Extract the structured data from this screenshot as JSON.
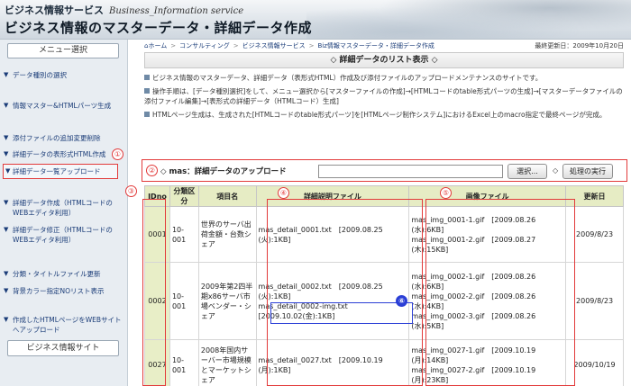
{
  "header": {
    "service_jp": "ビジネス情報サービス",
    "service_en": "Business_Information service",
    "title": "ビジネス情報のマスターデータ・詳細データ作成"
  },
  "sidebar": {
    "menu_title": "メニュー選択",
    "items": [
      {
        "label": "データ種別の選択"
      },
      {
        "label": "情報マスター&HTMLパーツ生成"
      },
      {
        "label": "添付ファイルの追加変更削除"
      },
      {
        "label": "詳細データの表形式HTML作成"
      },
      {
        "label": "詳細データ一覧アップロード"
      },
      {
        "label": "詳細データ作成（HTMLコードのWEBエディタ利用）"
      },
      {
        "label": "詳細データ修正（HTMLコードのWEBエディタ利用）"
      },
      {
        "label": "分類・タイトルファイル更新"
      },
      {
        "label": "背景カラー指定NOリスト表示"
      },
      {
        "label": "作成したHTMLページをWEBサイトへアップロード"
      }
    ],
    "bottom_button": "ビジネス情報サイト"
  },
  "breadcrumb": {
    "home": "ホーム",
    "items": [
      "コンサルティング",
      "ビジネス情報サービス",
      "Biz情報マスターデータ・詳細データ作成"
    ],
    "updated": "最終更新日：2009年10月20日"
  },
  "section": {
    "title": "◇ 詳細データのリスト表示 ◇",
    "descriptions": [
      "ビジネス情報のマスターデータ、詳細データ（表形式HTML）作成及び添付ファイルのアップロードメンテナンスのサイトです。",
      "操作手順は、[データ種別選択]をして、メニュー選択から[マスターファイルの作成]→[HTMLコードのtable形式パーツの生成]→[マスターデータファイルの添付ファイル編集]→[表形式の詳細データ（HTMLコード）生成]",
      "HTMLページ生成は、生成された[HTMLコードのtable形式パーツ]を[HTMLページ制作システム]におけるExcel上のmacro指定で最終ページが完成。"
    ]
  },
  "upload": {
    "label": "◇ mas：詳細データのアップロード",
    "input_value": "",
    "select_button": "選択...",
    "run_label": "◇",
    "run_button": "処理の実行"
  },
  "table": {
    "headers": [
      "IDno",
      "分類区分",
      "項目名",
      "詳細説明ファイル",
      "画像ファイル",
      "更新日"
    ],
    "rows": [
      {
        "id": "0001",
        "cls": "10-001",
        "name": "世界のサーバ出荷金額・台数シェア",
        "files": [
          "mas_detail_0001.txt　[2009.08.25",
          "(火):1KB]"
        ],
        "images": [
          "mas_img_0001-1.gif　[2009.08.26",
          "(水):6KB]",
          "mas_img_0001-2.gif　[2009.08.27",
          "(木):15KB]"
        ],
        "updated": "2009/8/23"
      },
      {
        "id": "0002",
        "cls": "10-001",
        "name": "2009年第2四半期x86サーバ市場ベンダー・シェア",
        "files": [
          "mas_detail_0002.txt　[2009.08.25",
          "(火):1KB]",
          "mas_detail_0002-img.txt",
          "[2009.10.02(金):1KB]"
        ],
        "images": [
          "mas_img_0002-1.gif　[2009.08.26",
          "(水):6KB]",
          "mas_img_0002-2.gif　[2009.08.26",
          "(水):4KB]",
          "mas_img_0002-3.gif　[2009.08.26",
          "(水):5KB]"
        ],
        "updated": "2009/8/23"
      },
      {
        "id": "0027",
        "cls": "10-001",
        "name": "2008年国内サーバー市場規模とマーケットシェア",
        "files": [
          "mas_detail_0027.txt　[2009.10.19",
          "(月):1KB]"
        ],
        "images": [
          "mas_img_0027-1.gif　[2009.10.19",
          "(月):14KB]",
          "mas_img_0027-2.gif　[2009.10.19",
          "(月):23KB]"
        ],
        "updated": "2009/10/19"
      }
    ]
  },
  "annotations": [
    "①",
    "②",
    "③",
    "④",
    "⑤",
    "⑥"
  ],
  "colors": {
    "accent_red": "#e23a3a",
    "accent_blue": "#2b3fd6",
    "table_header": "#e6ecc4",
    "link": "#1a3c78"
  }
}
